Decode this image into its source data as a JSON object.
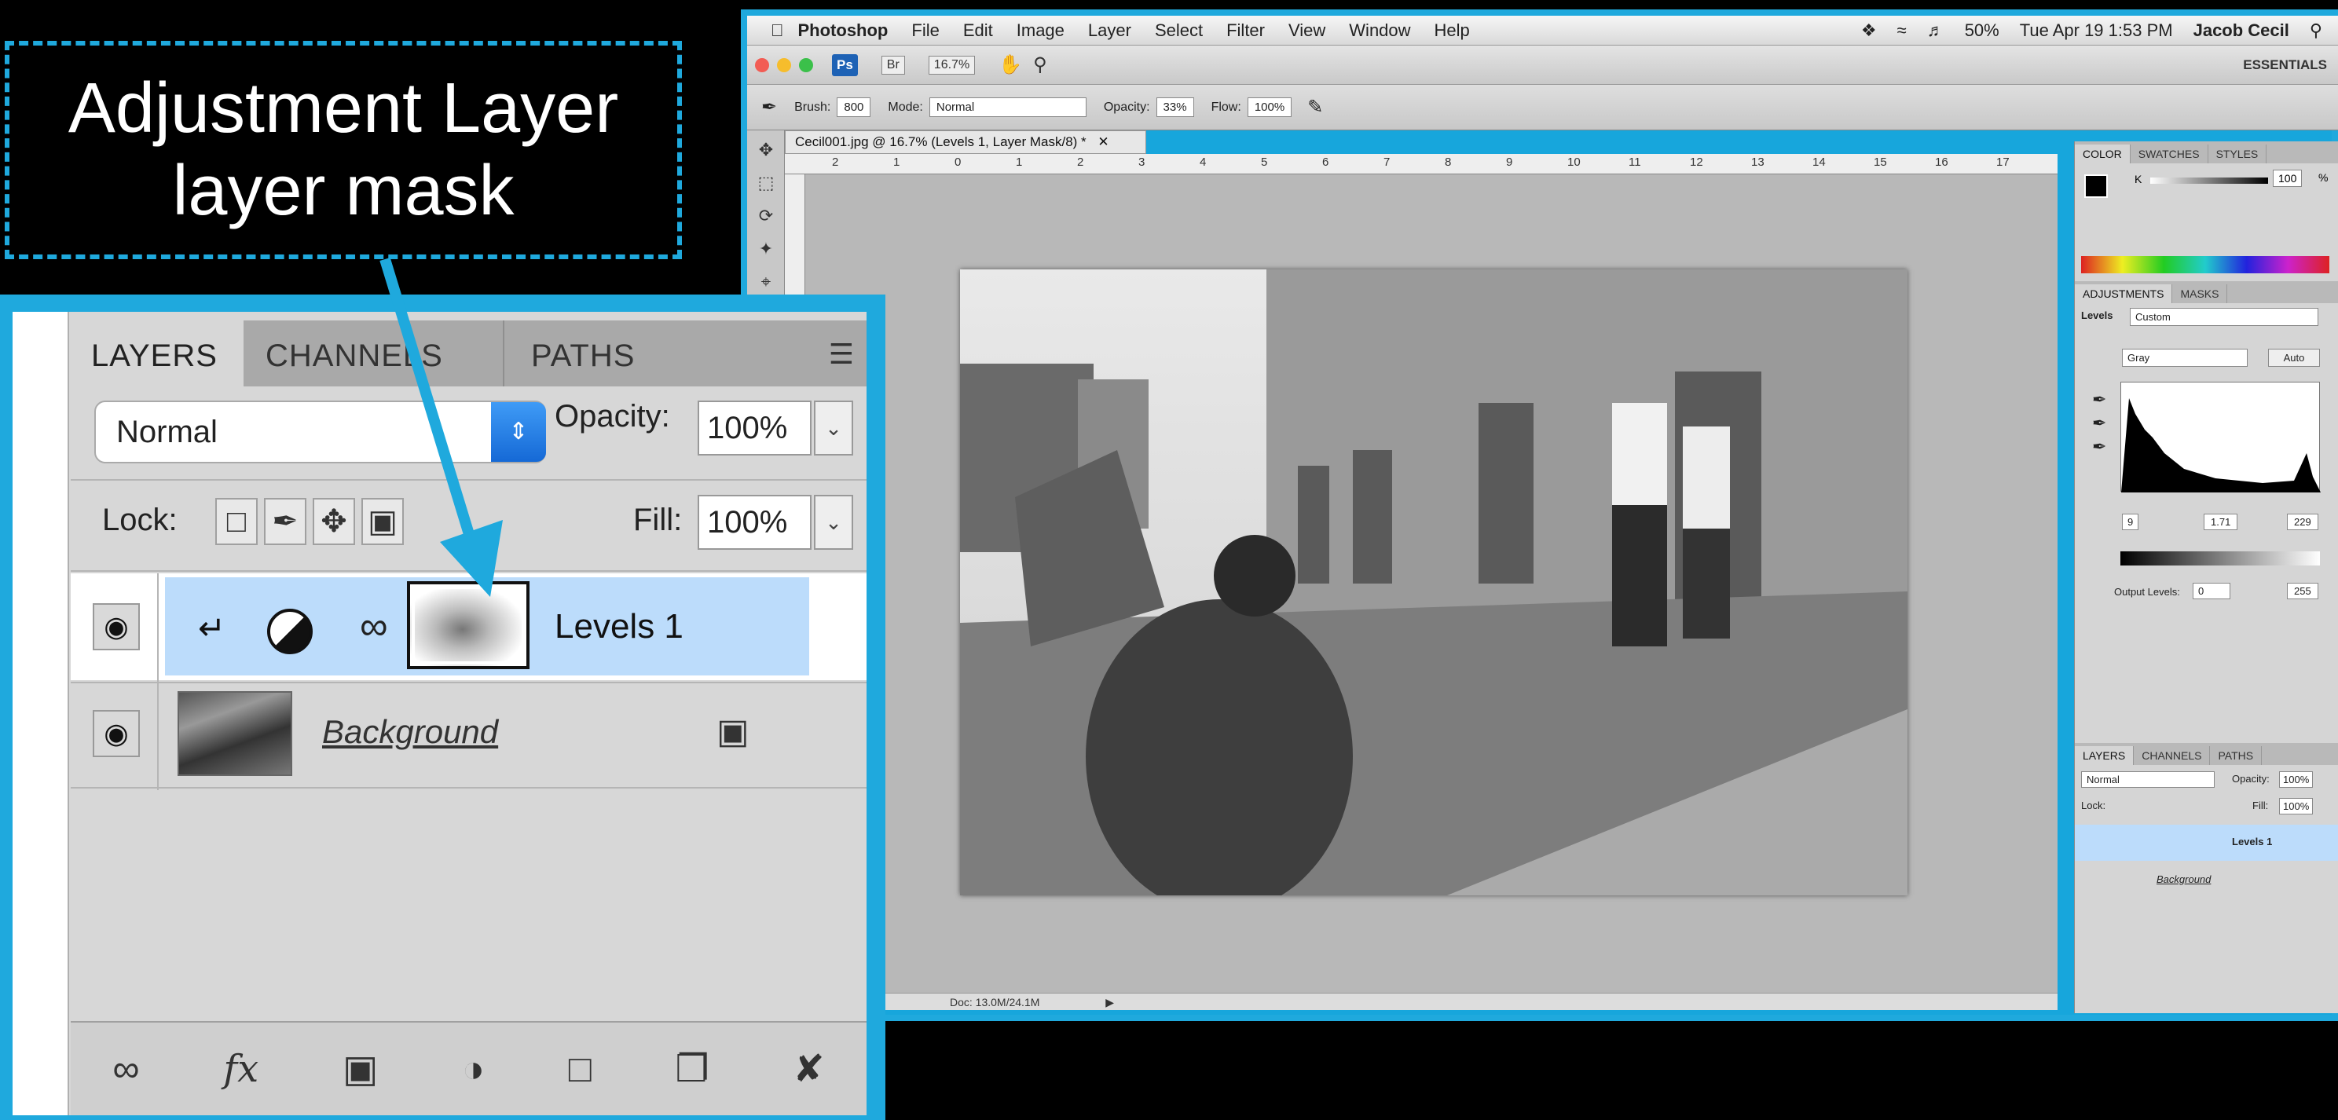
{
  "callout": {
    "line1": "Adjustment Layer",
    "line2": "layer mask"
  },
  "menubar": {
    "app": "Photoshop",
    "items": [
      "File",
      "Edit",
      "Image",
      "Layer",
      "Select",
      "Filter",
      "View",
      "Window",
      "Help"
    ],
    "battery": "50%",
    "datetime": "Tue Apr 19  1:53 PM",
    "user": "Jacob Cecil"
  },
  "appbar": {
    "ps": "Ps",
    "br": "Br",
    "zoom": "16.7%",
    "workspace": "ESSENTIALS"
  },
  "options": {
    "brush_label": "Brush:",
    "brush_size": "800",
    "mode_label": "Mode:",
    "mode": "Normal",
    "opacity_label": "Opacity:",
    "opacity": "33%",
    "flow_label": "Flow:",
    "flow": "100%"
  },
  "document": {
    "tab": "Cecil001.jpg @ 16.7% (Levels 1, Layer Mask/8) *",
    "ruler_ticks": [
      "2",
      "1",
      "0",
      "1",
      "2",
      "3",
      "4",
      "5",
      "6",
      "7",
      "8",
      "9",
      "10",
      "11",
      "12",
      "13",
      "14",
      "15",
      "16",
      "17"
    ],
    "status": "Doc: 13.0M/24.1M"
  },
  "color_panel": {
    "tabs": [
      "COLOR",
      "SWATCHES",
      "STYLES"
    ],
    "k_label": "K",
    "k_value": "100",
    "unit": "%"
  },
  "adjustments_panel": {
    "tabs": [
      "ADJUSTMENTS",
      "MASKS"
    ],
    "title": "Levels",
    "preset": "Custom",
    "channel": "Gray",
    "auto": "Auto",
    "input_black": "9",
    "input_gamma": "1.71",
    "input_white": "229",
    "output_label": "Output Levels:",
    "output_black": "0",
    "output_white": "255"
  },
  "layers_small": {
    "tabs": [
      "LAYERS",
      "CHANNELS",
      "PATHS"
    ],
    "blend": "Normal",
    "opacity_label": "Opacity:",
    "opacity": "100%",
    "lock_label": "Lock:",
    "fill_label": "Fill:",
    "fill": "100%",
    "layer1": "Levels 1",
    "layer2": "Background"
  },
  "layers_zoom": {
    "tabs": [
      "LAYERS",
      "CHANNELS",
      "PATHS"
    ],
    "blend": "Normal",
    "opacity_label": "Opacity:",
    "opacity": "100%",
    "lock_label": "Lock:",
    "fill_label": "Fill:",
    "fill": "100%",
    "layer1": "Levels 1",
    "layer2": "Background"
  },
  "colors": {
    "accent": "#1fa9dd",
    "selection": "#bcdcfb"
  }
}
